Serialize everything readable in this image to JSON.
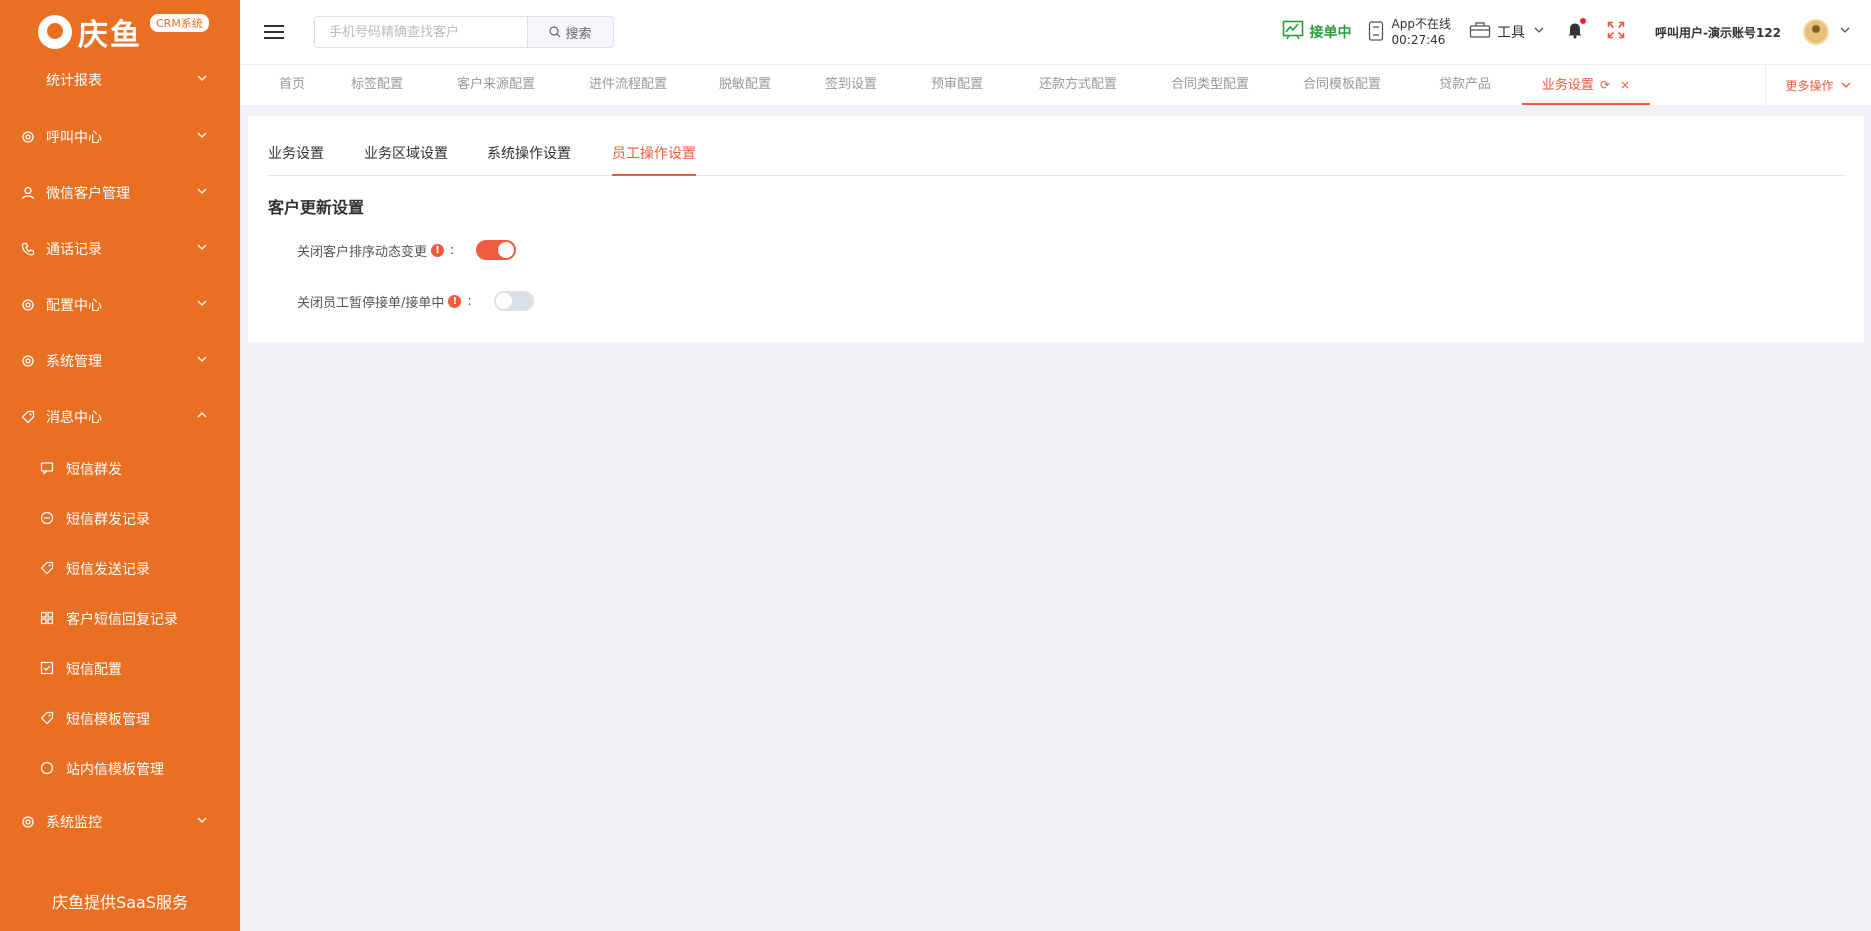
{
  "brand": {
    "name": "庆鱼",
    "badge": "CRM系统"
  },
  "sidebar": {
    "items": [
      {
        "label": "统计报表",
        "icon": "chart-icon",
        "expanded": false
      },
      {
        "label": "呼叫中心",
        "icon": "gear-icon",
        "expanded": false
      },
      {
        "label": "微信客户管理",
        "icon": "user-icon",
        "expanded": false
      },
      {
        "label": "通话记录",
        "icon": "phone-icon",
        "expanded": false
      },
      {
        "label": "配置中心",
        "icon": "gear-icon",
        "expanded": false
      },
      {
        "label": "系统管理",
        "icon": "gear-icon",
        "expanded": false
      },
      {
        "label": "消息中心",
        "icon": "tag-icon",
        "expanded": true
      },
      {
        "label": "系统监控",
        "icon": "gear-icon",
        "expanded": false
      }
    ],
    "subitems": [
      {
        "label": "短信群发",
        "icon": "message-icon"
      },
      {
        "label": "短信群发记录",
        "icon": "minus-circle-icon"
      },
      {
        "label": "短信发送记录",
        "icon": "tag-icon"
      },
      {
        "label": "客户短信回复记录",
        "icon": "grid-icon"
      },
      {
        "label": "短信配置",
        "icon": "checkbox-icon"
      },
      {
        "label": "短信模板管理",
        "icon": "tag-icon"
      },
      {
        "label": "站内信模板管理",
        "icon": "chat-bubble-icon"
      }
    ],
    "footer": "庆鱼提供SaaS服务"
  },
  "header": {
    "search_placeholder": "手机号码精确查找客户",
    "search_button": "搜索",
    "status_label": "接单中",
    "app_status_line1": "App不在线",
    "app_status_line2": "00:27:46",
    "tools_label": "工具",
    "user_name": "呼叫用户-演示账号122"
  },
  "tabs": {
    "items": [
      "首页",
      "标签配置",
      "客户来源配置",
      "进件流程配置",
      "脱敏配置",
      "签到设置",
      "预审配置",
      "还款方式配置",
      "合同类型配置",
      "合同模板配置",
      "贷款产品",
      "业务设置"
    ],
    "active": "业务设置",
    "more_label": "更多操作"
  },
  "content": {
    "sub_tabs": [
      "业务设置",
      "业务区域设置",
      "系统操作设置",
      "员工操作设置"
    ],
    "active_sub_tab": "员工操作设置",
    "section_title": "客户更新设置",
    "settings": [
      {
        "label": "关闭客户排序动态变更",
        "enabled": true
      },
      {
        "label": "关闭员工暂停接单/接单中",
        "enabled": false
      }
    ]
  },
  "colors": {
    "sidebar": "#e96f23",
    "accent": "#f05a3e",
    "online": "#2a9d3b"
  }
}
